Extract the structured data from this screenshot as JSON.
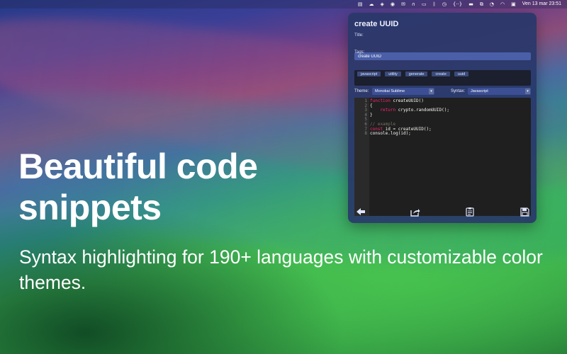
{
  "menubar": {
    "icons": [
      "activity-icon",
      "cloud-icon",
      "shortcut-icon",
      "record-icon",
      "mail-icon",
      "headphones-icon",
      "display-icon",
      "bluetooth-icon",
      "timer-icon",
      "braces-icon",
      "battery-icon",
      "airplay-icon",
      "clock-icon",
      "wifi-icon",
      "control-center-icon"
    ],
    "clock": "Ven 13 mar  23:51"
  },
  "panel": {
    "title": "create UUID",
    "title_label": "Title:",
    "title_value": "create UUID",
    "tags_label": "Tags:",
    "tags": [
      "javascript",
      "utility",
      "generate",
      "create",
      "uuid"
    ],
    "theme_label": "Theme:",
    "theme_value": "Monokai Sublime",
    "syntax_label": "Syntax:",
    "syntax_value": "Javascript",
    "line_numbers": [
      "1",
      "2",
      "3",
      "4",
      "5",
      "6",
      "7",
      "8"
    ],
    "code": {
      "l1_kw": "function",
      "l1_rest": " createUUID()",
      "l2": "{",
      "l3_kw": "    return",
      "l3_rest": " crypto.randomUUID();",
      "l4": "}",
      "l6": "// example",
      "l7_kw": "const",
      "l7_rest": " id = createUUID();",
      "l8": "console.log(id);"
    }
  },
  "hero": {
    "heading": "Beautiful code snippets",
    "subtitle": "Syntax highlighting for 190+ languages with customizable color themes."
  },
  "colors": {
    "panel_bg": "#28376a",
    "editor_bg": "#1f1f1f",
    "keyword": "#f92672",
    "comment": "#75715e"
  }
}
